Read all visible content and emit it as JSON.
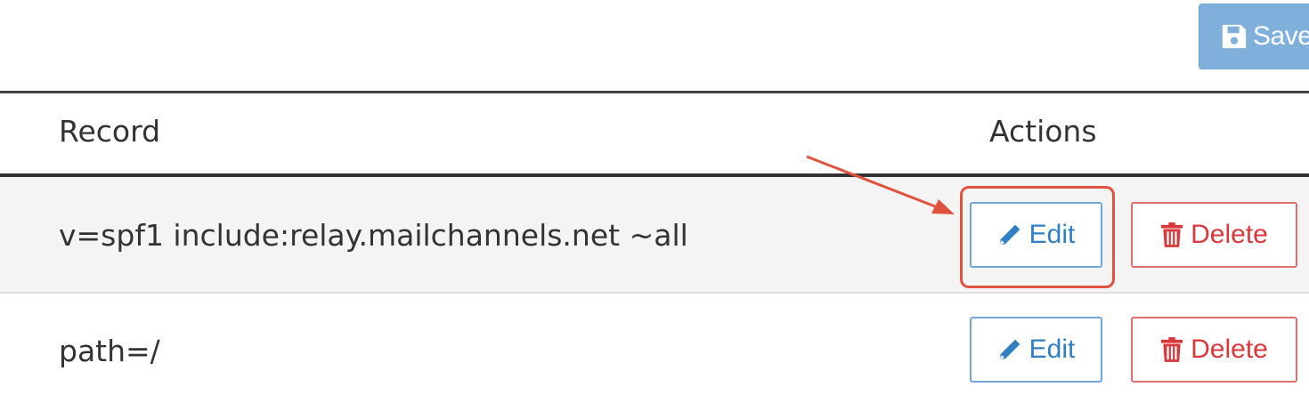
{
  "toolbar": {
    "save_label": "Save"
  },
  "table": {
    "columns": {
      "record": "Record",
      "actions": "Actions"
    },
    "rows": [
      {
        "record": "v=spf1 include:relay.mailchannels.net ~all",
        "edit_label": "Edit",
        "delete_label": "Delete"
      },
      {
        "record": "path=/",
        "edit_label": "Edit",
        "delete_label": "Delete"
      }
    ]
  },
  "colors": {
    "save_bg": "#7fb0dc",
    "edit_border": "#6ea6dc",
    "edit_text": "#2f7fc4",
    "delete_border": "#e07070",
    "delete_text": "#d9383a",
    "annotation": "#e0533f"
  },
  "icons": {
    "save": "floppy-disk-icon",
    "edit": "pencil-icon",
    "delete": "trash-icon"
  }
}
